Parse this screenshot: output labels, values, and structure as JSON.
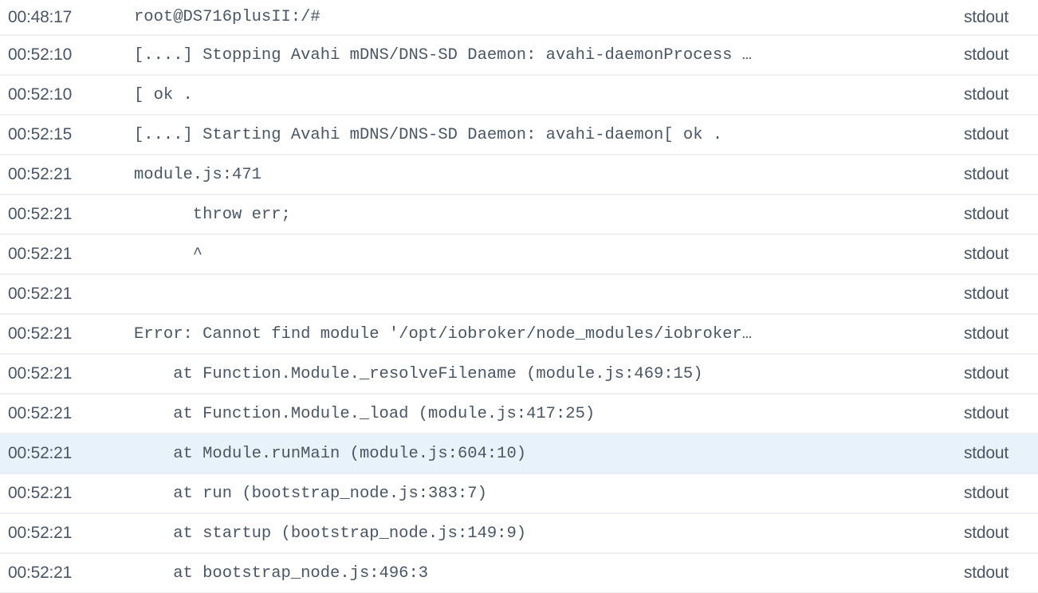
{
  "table": {
    "columns": [
      "time",
      "message",
      "severity"
    ],
    "highlighted_row_index": 11,
    "colors": {
      "background": "#ffffff",
      "row_separator": "#eef0f3",
      "text": "#4c5663",
      "row_highlight": "#e8f2fa"
    },
    "rows": [
      {
        "time": "00:48:17",
        "message": "root@DS716plusII:/#",
        "severity": "stdout"
      },
      {
        "time": "00:52:10",
        "message": "[....] Stopping Avahi mDNS/DNS-SD Daemon: avahi-daemonProcess …",
        "severity": "stdout"
      },
      {
        "time": "00:52:10",
        "message": "[ ok .",
        "severity": "stdout"
      },
      {
        "time": "00:52:15",
        "message": "[....] Starting Avahi mDNS/DNS-SD Daemon: avahi-daemon[ ok .",
        "severity": "stdout"
      },
      {
        "time": "00:52:21",
        "message": "module.js:471",
        "severity": "stdout"
      },
      {
        "time": "00:52:21",
        "message": "      throw err;",
        "severity": "stdout"
      },
      {
        "time": "00:52:21",
        "message": "      ^",
        "severity": "stdout"
      },
      {
        "time": "00:52:21",
        "message": "",
        "severity": "stdout"
      },
      {
        "time": "00:52:21",
        "message": "Error: Cannot find module '/opt/iobroker/node_modules/iobroker…",
        "severity": "stdout"
      },
      {
        "time": "00:52:21",
        "message": "    at Function.Module._resolveFilename (module.js:469:15)",
        "severity": "stdout"
      },
      {
        "time": "00:52:21",
        "message": "    at Function.Module._load (module.js:417:25)",
        "severity": "stdout"
      },
      {
        "time": "00:52:21",
        "message": "    at Module.runMain (module.js:604:10)",
        "severity": "stdout"
      },
      {
        "time": "00:52:21",
        "message": "    at run (bootstrap_node.js:383:7)",
        "severity": "stdout"
      },
      {
        "time": "00:52:21",
        "message": "    at startup (bootstrap_node.js:149:9)",
        "severity": "stdout"
      },
      {
        "time": "00:52:21",
        "message": "    at bootstrap_node.js:496:3",
        "severity": "stdout"
      }
    ]
  }
}
